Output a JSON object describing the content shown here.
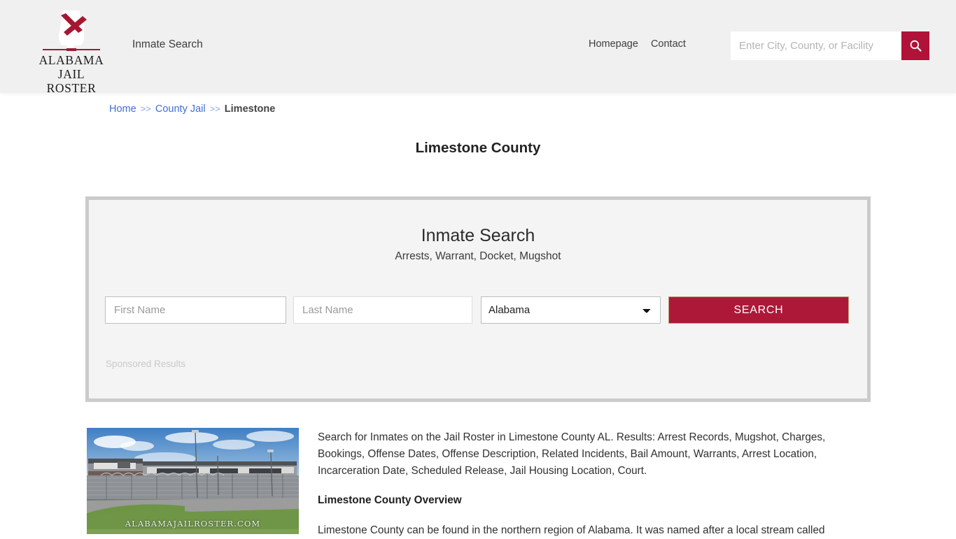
{
  "header": {
    "logo": {
      "line1": "ALABAMA",
      "line2": "JAIL ROSTER",
      "icon": "alabama-flag-state-icon"
    },
    "primary_nav_label": "Inmate Search",
    "links": [
      {
        "label": "Homepage"
      },
      {
        "label": "Contact"
      }
    ],
    "search": {
      "placeholder": "Enter City, County, or Facility",
      "value": "",
      "button_icon": "search-icon"
    },
    "background_color": "#f0f0f0",
    "accent_color": "#b01238"
  },
  "breadcrumb": {
    "items": [
      {
        "label": "Home",
        "link": true
      },
      {
        "label": "County Jail",
        "link": true
      },
      {
        "label": "Limestone",
        "link": false
      }
    ],
    "separator": ">>"
  },
  "page": {
    "title": "Limestone County"
  },
  "search_panel": {
    "heading": "Inmate Search",
    "subheading": "Arrests, Warrant, Docket, Mugshot",
    "first_name": {
      "placeholder": "First Name",
      "value": ""
    },
    "last_name": {
      "placeholder": "Last Name",
      "value": ""
    },
    "state": {
      "selected": "Alabama",
      "options": [
        "Alabama"
      ]
    },
    "submit_label": "SEARCH",
    "submit_color": "#ad1838",
    "sponsored_label": "Sponsored Results"
  },
  "content": {
    "photo": {
      "alt": "Limestone County Jail facility",
      "watermark": "ALABAMAJAILROSTER.COM"
    },
    "intro_paragraph": "Search for Inmates on the Jail Roster in Limestone County AL. Results: Arrest Records, Mugshot, Charges, Bookings, Offense Dates, Offense Description, Related Incidents, Bail Amount, Warrants, Arrest Location, Incarceration Date, Scheduled Release, Jail Housing Location, Court.",
    "overview_heading": "Limestone County Overview",
    "overview_paragraph": "Limestone County can be found in the northern region of Alabama. It was named after a local stream called"
  }
}
